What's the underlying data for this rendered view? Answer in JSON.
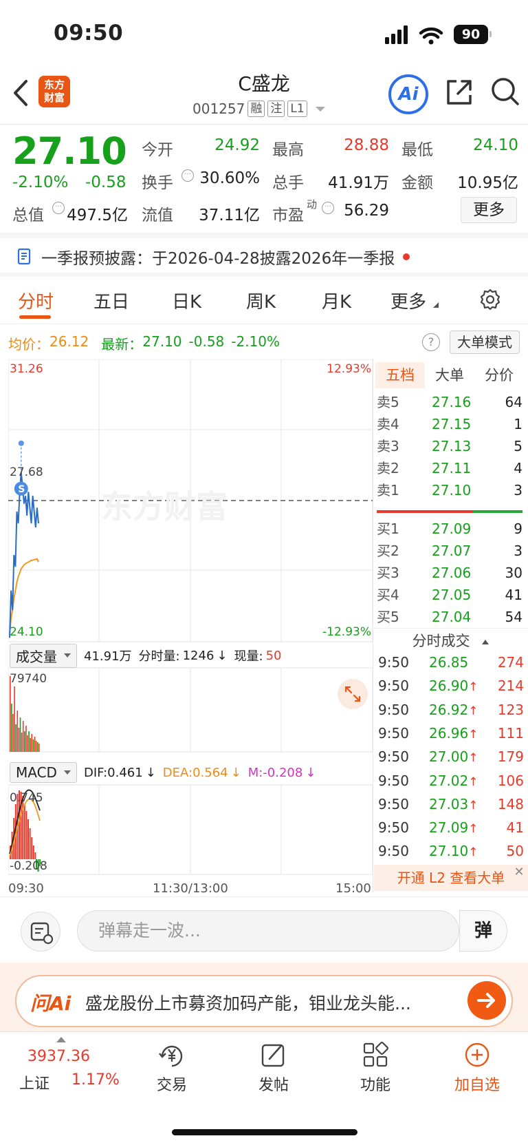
{
  "status": {
    "time": "09:50",
    "battery": "90"
  },
  "header": {
    "logo_line1": "东方",
    "logo_line2": "财富",
    "stock_name": "C盛龙",
    "stock_code": "001257",
    "tags": [
      "融",
      "注",
      "L1"
    ],
    "ai_label": "Ai"
  },
  "quote": {
    "price": "27.10",
    "change_pct": "-2.10%",
    "change_amt": "-0.58",
    "open_label": "今开",
    "open": "24.92",
    "high_label": "最高",
    "high": "28.88",
    "low_label": "最低",
    "low": "24.10",
    "turnover_label": "换手",
    "turnover": "30.60%",
    "volume_label": "总手",
    "volume": "41.91万",
    "amount_label": "金额",
    "amount": "10.95亿",
    "mktcap_label": "总值",
    "mktcap": "497.5亿",
    "float_label": "流值",
    "float": "37.11亿",
    "pe_label": "市盈",
    "pe_sup": "动",
    "pe": "56.29",
    "more_label": "更多"
  },
  "notice": {
    "text": "一季报预披露：于2026-04-28披露2026年一季报"
  },
  "tabs": [
    "分时",
    "五日",
    "日K",
    "周K",
    "月K",
    "更多"
  ],
  "avg_row": {
    "avg_label": "均价：",
    "avg": "26.12",
    "latest_label": "最新：",
    "latest": "27.10",
    "chg": "-0.58",
    "pct": "-2.10%",
    "help": "?",
    "bigorder_label": "大单模式"
  },
  "chart": {
    "price_top": "31.26",
    "price_mid": "27.68",
    "price_bottom": "24.10",
    "pct_top": "12.93%",
    "pct_bottom": "-12.93%",
    "watermark": "东方财富",
    "vol_selector": "成交量",
    "vol_total": "41.91万",
    "vol_minute_label": "分时量:",
    "vol_minute": "1246",
    "vol_now_label": "现量:",
    "vol_now": "50",
    "vol_max": "79740",
    "macd_selector": "MACD",
    "dif": "DIF:0.461",
    "dea": "DEA:0.564",
    "m": "M:-0.208",
    "macd_top": "0.745",
    "macd_bottom": "-0.208",
    "time_start": "09:30",
    "time_mid": "11:30/13:00",
    "time_end": "15:00"
  },
  "chart_data": {
    "type": "line",
    "x": [
      "09:30",
      "09:31",
      "09:32",
      "09:33",
      "09:34",
      "09:35",
      "09:36",
      "09:37",
      "09:38",
      "09:39",
      "09:40",
      "09:41",
      "09:42",
      "09:43",
      "09:44",
      "09:45",
      "09:46",
      "09:47",
      "09:48",
      "09:49",
      "09:50"
    ],
    "series": [
      {
        "values": [
          24.2,
          25.4,
          24.9,
          26.3,
          26.0,
          27.4,
          27.1,
          27.9,
          28.4,
          28.0,
          27.6,
          27.8,
          27.3,
          27.9,
          27.5,
          27.1,
          27.8,
          27.4,
          27.0,
          27.5,
          27.1
        ]
      },
      {
        "values": [
          24.3,
          24.7,
          24.9,
          25.2,
          25.4,
          25.6,
          25.75,
          25.85,
          25.95,
          26.0,
          26.05,
          26.08,
          26.1,
          26.12,
          26.14,
          26.16,
          26.17,
          26.18,
          26.19,
          26.2,
          26.12
        ]
      }
    ],
    "ylim": [
      24.1,
      31.26
    ]
  },
  "orderbook": {
    "tabs": [
      "五档",
      "大单",
      "分价"
    ],
    "asks": [
      {
        "label": "卖5",
        "price": "27.16",
        "vol": "64"
      },
      {
        "label": "卖4",
        "price": "27.15",
        "vol": "1"
      },
      {
        "label": "卖3",
        "price": "27.13",
        "vol": "5"
      },
      {
        "label": "卖2",
        "price": "27.11",
        "vol": "4"
      },
      {
        "label": "卖1",
        "price": "27.10",
        "vol": "3"
      }
    ],
    "bids": [
      {
        "label": "买1",
        "price": "27.09",
        "vol": "9"
      },
      {
        "label": "买2",
        "price": "27.07",
        "vol": "3"
      },
      {
        "label": "买3",
        "price": "27.06",
        "vol": "30"
      },
      {
        "label": "买4",
        "price": "27.05",
        "vol": "41"
      },
      {
        "label": "买5",
        "price": "27.04",
        "vol": "54"
      }
    ],
    "trades_title": "分时成交",
    "trades": [
      {
        "t": "9:50",
        "p": "26.85",
        "up": "",
        "v": "274"
      },
      {
        "t": "9:50",
        "p": "26.90",
        "up": "↑",
        "v": "214"
      },
      {
        "t": "9:50",
        "p": "26.92",
        "up": "↑",
        "v": "123"
      },
      {
        "t": "9:50",
        "p": "26.96",
        "up": "↑",
        "v": "111"
      },
      {
        "t": "9:50",
        "p": "27.00",
        "up": "↑",
        "v": "179"
      },
      {
        "t": "9:50",
        "p": "27.02",
        "up": "↑",
        "v": "106"
      },
      {
        "t": "9:50",
        "p": "27.03",
        "up": "↑",
        "v": "148"
      },
      {
        "t": "9:50",
        "p": "27.09",
        "up": "↑",
        "v": "41"
      },
      {
        "t": "9:50",
        "p": "27.10",
        "up": "↑",
        "v": "50"
      }
    ],
    "l2_banner": "开通 L2 查看大单"
  },
  "danmu": {
    "placeholder": "弹幕走一波...",
    "toggle": "弹"
  },
  "askai": {
    "logo": "问Ai",
    "text": "盛龙股份上市募资加码产能，钼业龙头能..."
  },
  "nav": {
    "index_value": "3937.36",
    "index_name": "上证",
    "index_pct": "1.17%",
    "items": [
      "交易",
      "发帖",
      "功能",
      "加自选"
    ]
  }
}
